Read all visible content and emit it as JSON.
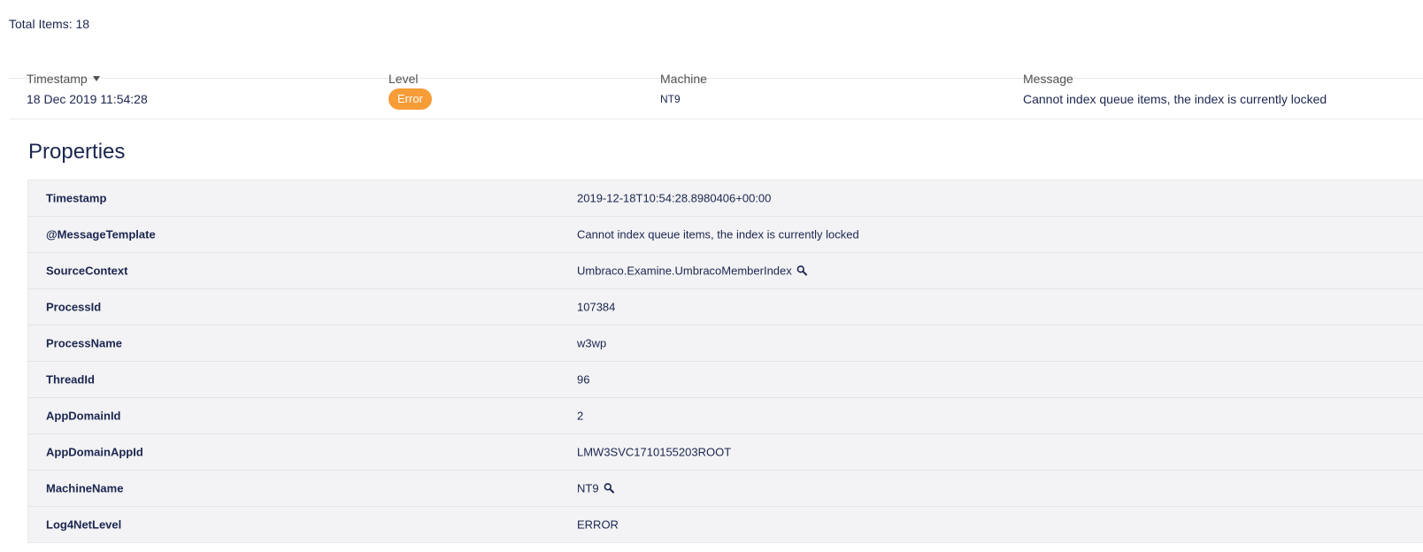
{
  "summary": {
    "total_items_label": "Total Items: 18"
  },
  "log_table": {
    "columns": {
      "timestamp": "Timestamp",
      "level": "Level",
      "machine": "Machine",
      "message": "Message"
    },
    "sort_indicator": "caret-down-icon",
    "rows": [
      {
        "timestamp": "18 Dec 2019 11:54:28",
        "level": "Error",
        "machine": "NT9",
        "message": "Cannot index queue items, the index is currently locked"
      }
    ]
  },
  "properties": {
    "title": "Properties",
    "items": [
      {
        "key": "Timestamp",
        "value": "2019-12-18T10:54:28.8980406+00:00",
        "searchable": false
      },
      {
        "key": "@MessageTemplate",
        "value": "Cannot index queue items, the index is currently locked",
        "searchable": false
      },
      {
        "key": "SourceContext",
        "value": "Umbraco.Examine.UmbracoMemberIndex",
        "searchable": true
      },
      {
        "key": "ProcessId",
        "value": "107384",
        "searchable": false
      },
      {
        "key": "ProcessName",
        "value": "w3wp",
        "searchable": false
      },
      {
        "key": "ThreadId",
        "value": "96",
        "searchable": false
      },
      {
        "key": "AppDomainId",
        "value": "2",
        "searchable": false
      },
      {
        "key": "AppDomainAppId",
        "value": "LMW3SVC1710155203ROOT",
        "searchable": false
      },
      {
        "key": "MachineName",
        "value": "NT9",
        "searchable": true
      },
      {
        "key": "Log4NetLevel",
        "value": "ERROR",
        "searchable": false
      }
    ]
  },
  "colors": {
    "error_badge": "#f79c37",
    "text": "#1b264f",
    "properties_bg": "#f3f3f5"
  }
}
